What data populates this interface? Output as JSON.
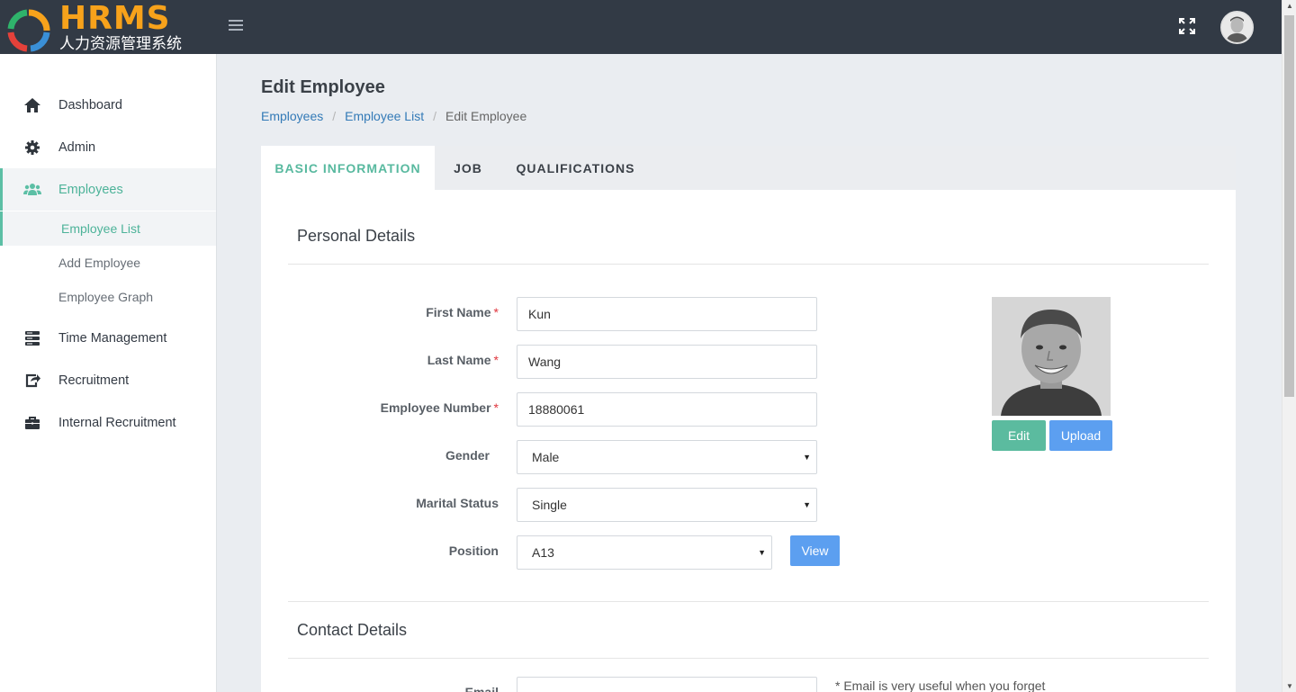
{
  "brand": {
    "title": "HRMS",
    "subtitle": "人力资源管理系统",
    "accent": "#f7a21b"
  },
  "topbar": {
    "menu_icon": "hamburger-icon",
    "fullscreen_icon": "expand-icon",
    "avatar_icon": "user-avatar"
  },
  "sidebar": {
    "items": [
      {
        "label": "Dashboard",
        "icon": "home-icon"
      },
      {
        "label": "Admin",
        "icon": "gear-icon"
      },
      {
        "label": "Employees",
        "icon": "users-icon"
      },
      {
        "label": "Time Management",
        "icon": "server-icon"
      },
      {
        "label": "Recruitment",
        "icon": "share-icon"
      },
      {
        "label": "Internal Recruitment",
        "icon": "briefcase-icon"
      }
    ],
    "sub_items": [
      {
        "label": "Employee List"
      },
      {
        "label": "Add Employee"
      },
      {
        "label": "Employee Graph"
      }
    ],
    "active_color": "#5cbfa5"
  },
  "page": {
    "title": "Edit Employee",
    "breadcrumb": [
      "Employees",
      "Employee List",
      "Edit Employee"
    ]
  },
  "tabs": [
    {
      "label": "BASIC INFORMATION"
    },
    {
      "label": "JOB"
    },
    {
      "label": "QUALIFICATIONS"
    }
  ],
  "personal": {
    "section_title": "Personal Details",
    "first_name_label": "First Name",
    "first_name": "Kun",
    "last_name_label": "Last Name",
    "last_name": "Wang",
    "employee_number_label": "Employee Number",
    "employee_number": "18880061",
    "gender_label": "Gender",
    "gender": "Male",
    "marital_label": "Marital Status",
    "marital": "Single",
    "position_label": "Position",
    "position": "A13",
    "view_label": "View",
    "required_mark": "*"
  },
  "photo": {
    "edit_label": "Edit",
    "upload_label": "Upload"
  },
  "contact": {
    "section_title": "Contact Details",
    "email_label": "Email",
    "email": "",
    "email_note": "* Email is very useful when you forget"
  },
  "colors": {
    "topbar": "#323a45",
    "green_button": "#5bbb9f",
    "blue_button": "#5c9ff0",
    "required": "#e0353d"
  }
}
